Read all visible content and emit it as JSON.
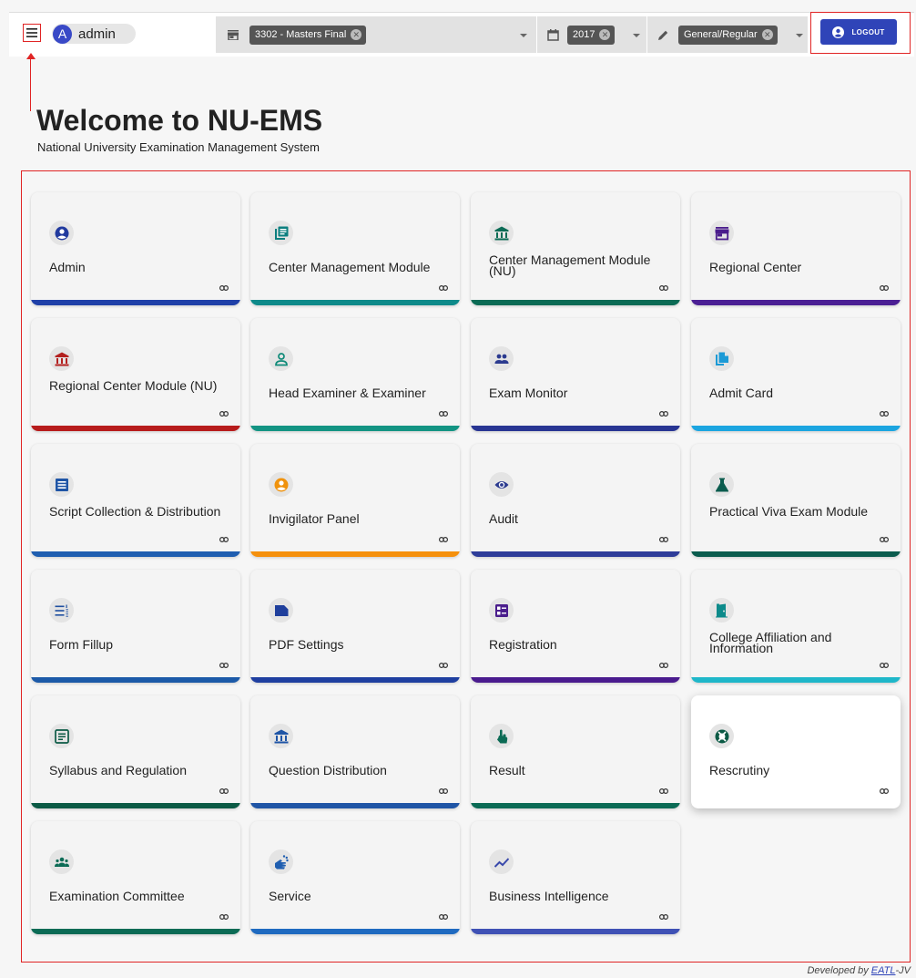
{
  "header": {
    "user": {
      "avatar_letter": "A",
      "name": "admin"
    },
    "filters": {
      "program": "3302 - Masters Final",
      "year": "2017",
      "exam_type": "General/Regular"
    },
    "logout_label": "LOGOUT"
  },
  "welcome": {
    "title": "Welcome to NU-EMS",
    "subtitle": "National University Examination Management System"
  },
  "modules": [
    {
      "label": "Admin",
      "icon": "account-circle-icon",
      "icon_color": "#213a9e",
      "bar_color": "#1f40a8",
      "link_icon": "link-icon"
    },
    {
      "label": "Center Management Module",
      "icon": "library-books-icon",
      "icon_color": "#0c7f7f",
      "bar_color": "#0e8a8a",
      "link_icon": "link-icon"
    },
    {
      "label": "Center Management Module (NU)",
      "icon": "institution-icon",
      "icon_color": "#0b6b55",
      "bar_color": "#0b6b55",
      "link_icon": "link-icon"
    },
    {
      "label": "Regional Center",
      "icon": "store-icon",
      "icon_color": "#4a1d8c",
      "bar_color": "#4b1f94",
      "link_icon": "link-icon"
    },
    {
      "label": "Regional Center Module (NU)",
      "icon": "institution-icon",
      "icon_color": "#b3201f",
      "bar_color": "#b71c1c",
      "link_icon": "link-icon"
    },
    {
      "label": "Head Examiner & Examiner",
      "icon": "person-outline-icon",
      "icon_color": "#0f8a78",
      "bar_color": "#139483",
      "link_icon": "link-icon"
    },
    {
      "label": "Exam Monitor",
      "icon": "people-icon",
      "icon_color": "#2b3a8f",
      "bar_color": "#283593",
      "link_icon": "link-icon"
    },
    {
      "label": "Admit Card",
      "icon": "file-copy-icon",
      "icon_color": "#1b9ad6",
      "bar_color": "#1ba5e0",
      "link_icon": "link-icon"
    },
    {
      "label": "Script Collection & Distribution",
      "icon": "list-alt-icon",
      "icon_color": "#1f55a6",
      "bar_color": "#1f5eb0",
      "link_icon": "link-icon"
    },
    {
      "label": "Invigilator Panel",
      "icon": "account-circle-icon",
      "icon_color": "#f0920c",
      "bar_color": "#f5900c",
      "link_icon": "link-icon"
    },
    {
      "label": "Audit",
      "icon": "eye-icon",
      "icon_color": "#2b3a8f",
      "bar_color": "#2e3d99",
      "link_icon": "link-icon"
    },
    {
      "label": "Practical Viva Exam Module",
      "icon": "flask-icon",
      "icon_color": "#0b5c4e",
      "bar_color": "#0b5c4e",
      "link_icon": "link-icon"
    },
    {
      "label": "Form Fillup",
      "icon": "format-list-numbered-icon",
      "icon_color": "#1f4fa0",
      "bar_color": "#1c5aa8",
      "link_icon": "link-icon"
    },
    {
      "label": "PDF Settings",
      "icon": "bookmark-label-icon",
      "icon_color": "#1f3f9c",
      "bar_color": "#1f3fa0",
      "link_icon": "link-icon"
    },
    {
      "label": "Registration",
      "icon": "list-details-icon",
      "icon_color": "#4a1d8c",
      "bar_color": "#4a1b8e",
      "link_icon": "link-icon"
    },
    {
      "label": "College Affiliation and Information",
      "icon": "door-icon",
      "icon_color": "#0c8a8a",
      "bar_color": "#1fb7c9",
      "link_icon": "link-icon"
    },
    {
      "label": "Syllabus and Regulation",
      "icon": "article-icon",
      "icon_color": "#0b5a45",
      "bar_color": "#0b5a45",
      "link_icon": "link-icon"
    },
    {
      "label": "Question Distribution",
      "icon": "institution-icon",
      "icon_color": "#1f55a6",
      "bar_color": "#1f55a6",
      "link_icon": "link-icon"
    },
    {
      "label": "Result",
      "icon": "touch-app-icon",
      "icon_color": "#0b6b55",
      "bar_color": "#0b6b55",
      "link_icon": "link-icon"
    },
    {
      "label": "Rescrutiny",
      "icon": "support-icon",
      "icon_color": "#0b5a45",
      "bar_color": "",
      "link_icon": "link-icon"
    },
    {
      "label": "Examination Committee",
      "icon": "groups-icon",
      "icon_color": "#0b6b55",
      "bar_color": "#0b6b55",
      "link_icon": "link-icon"
    },
    {
      "label": "Service",
      "icon": "hand-service-icon",
      "icon_color": "#1f5eb0",
      "bar_color": "#1f6ac0",
      "link_icon": "link-icon"
    },
    {
      "label": "Business Intelligence",
      "icon": "trending-up-icon",
      "icon_color": "#3949ab",
      "bar_color": "#3f51b5",
      "link_icon": "link-icon"
    }
  ],
  "footer": {
    "prefix": "Developed by ",
    "link": "EATL",
    "suffix": "-JV"
  }
}
